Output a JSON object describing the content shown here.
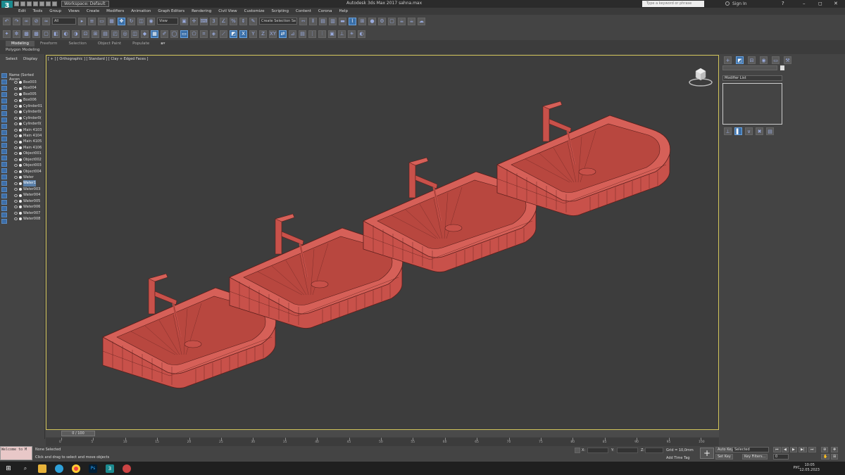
{
  "titlebar": {
    "workspace": "Workspace: Default",
    "title": "Autodesk 3ds Max 2017    sahna.max",
    "search_placeholder": "Type a keyword or phrase",
    "sign_in": "Sign In"
  },
  "menu": [
    "Edit",
    "Tools",
    "Group",
    "Views",
    "Create",
    "Modifiers",
    "Animation",
    "Graph Editors",
    "Rendering",
    "Civil View",
    "Customize",
    "Scripting",
    "Content",
    "Corona",
    "Help"
  ],
  "toolbar": {
    "filter_value": "All",
    "refcoord_value": "View",
    "selection_set_placeholder": "Create Selection Se"
  },
  "ribbon": {
    "tabs": [
      "Modeling",
      "Freeform",
      "Selection",
      "Object Paint",
      "Populate"
    ],
    "active_tab": "Modeling",
    "subtitle": "Polygon Modeling"
  },
  "scene_explorer": {
    "tabs": [
      "Select",
      "Display"
    ],
    "header": "Name (Sorted Ascen",
    "items": [
      "Box003",
      "Box004",
      "Box005",
      "Box006",
      "Cylinder01",
      "Cylinder0(",
      "Cylinder0(",
      "Cylinder0(",
      "Main 4103",
      "Main 4104",
      "Main 4105",
      "Main 4106",
      "Object001",
      "Object002",
      "Object003",
      "Object004",
      "Water",
      "Water1",
      "Water003",
      "Water004",
      "Water005",
      "Water006",
      "Water007",
      "Water008"
    ]
  },
  "viewport": {
    "label": "[ + ] [ Orthographic ] [ Standard ] [ Clay + Edged Faces ]",
    "sink_color": "#c8514a",
    "edge_color": "#5a1f1c"
  },
  "command_panel": {
    "modifier_list": "Modifier List"
  },
  "timeline": {
    "frame": "0 / 100",
    "ticks": [
      "0",
      "5",
      "10",
      "15",
      "20",
      "25",
      "30",
      "35",
      "40",
      "45",
      "50",
      "55",
      "60",
      "65",
      "70",
      "75",
      "80",
      "85",
      "90",
      "95",
      "100"
    ]
  },
  "maxscript": "Welcome to M",
  "status": {
    "selection": "None Selected",
    "prompt": "Click and drag to select and move objects",
    "x_label": "X:",
    "y_label": "Y:",
    "z_label": "Z:",
    "grid": "Grid = 10,0mm",
    "add_time_tag": "Add Time Tag"
  },
  "anim": {
    "auto_key": "Auto Key",
    "set_key": "Set Key",
    "selected": "Selected",
    "key_filters": "Key Filters...",
    "frame_value": "0"
  },
  "taskbar": {
    "lang": "РУС",
    "time": "10:05",
    "date": "12.05.2023"
  }
}
